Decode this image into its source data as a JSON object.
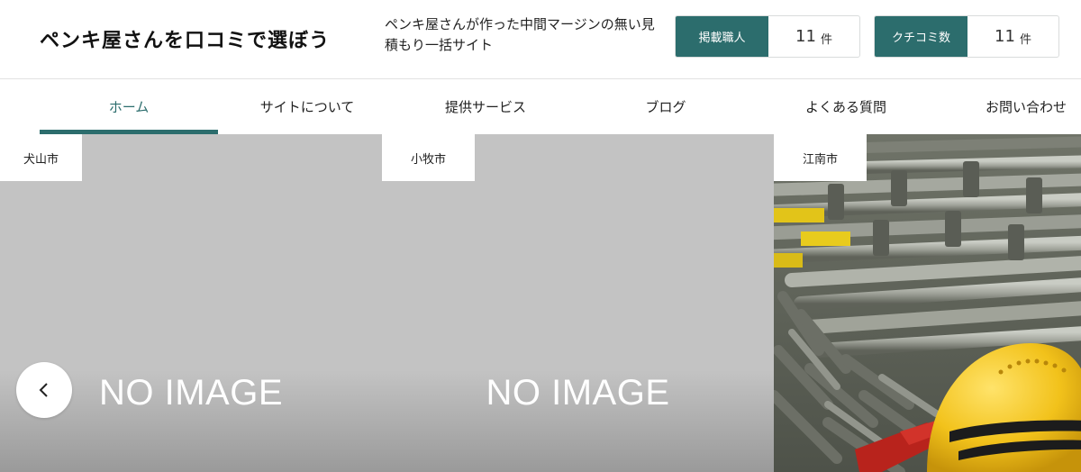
{
  "site": {
    "logo": "ペンキ屋さんを口コミで選ぼう",
    "tagline": "ペンキ屋さんが作った中間マージンの無い見積もり一括サイト"
  },
  "stats": [
    {
      "label": "掲載職人",
      "value": "11",
      "unit": "件"
    },
    {
      "label": "クチコミ数",
      "value": "11",
      "unit": "件"
    }
  ],
  "nav": [
    {
      "label": "ホーム",
      "active": true
    },
    {
      "label": "サイトについて"
    },
    {
      "label": "提供サービス"
    },
    {
      "label": "ブログ"
    },
    {
      "label": "よくある質問"
    },
    {
      "label": "お問い合わせ"
    }
  ],
  "slides": [
    {
      "city": "犬山市",
      "image_text": "NO IMAGE"
    },
    {
      "city": "小牧市",
      "image_text": "NO IMAGE"
    },
    {
      "city": "江南市",
      "image": "scaffolding-and-helmet-photo"
    }
  ],
  "icons": {
    "prev": "chevron-left-icon"
  },
  "colors": {
    "accent": "#2c6d6d",
    "placeholder": "#c3c3c3"
  }
}
